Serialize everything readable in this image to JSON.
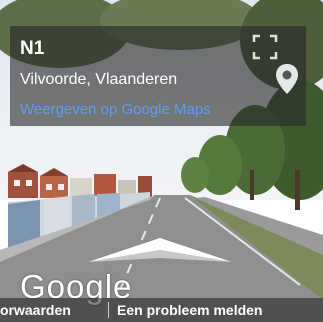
{
  "panel": {
    "title": "N1",
    "address": "Vilvoorde, Vlaanderen",
    "maps_link": "Weergeven op Google Maps"
  },
  "branding": {
    "logo": "Google"
  },
  "footer": {
    "terms": "orwaarden",
    "report": "Een probleem melden"
  },
  "icons": {
    "expand": "expand-icon",
    "pin": "map-pin-icon",
    "arrow": "navigation-arrow-icon"
  },
  "colors": {
    "link": "#5b9df5",
    "overlay": "rgba(40,40,40,0.62)"
  }
}
